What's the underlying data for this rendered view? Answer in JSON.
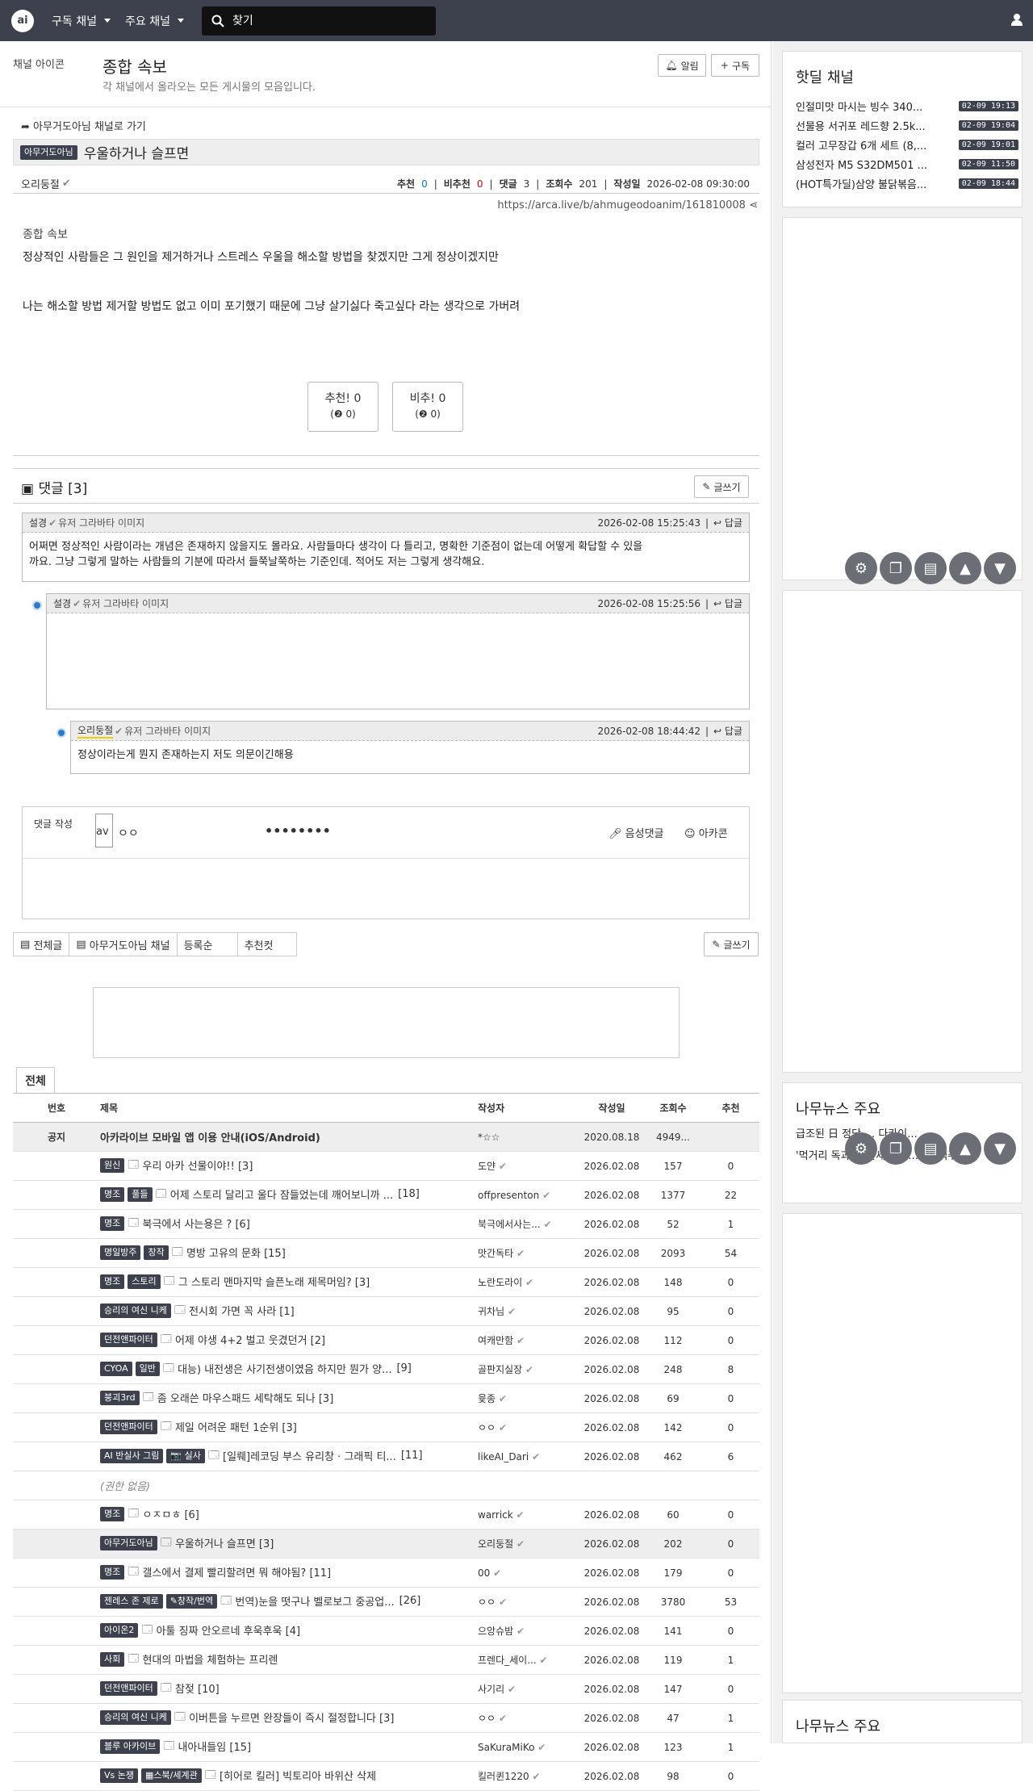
{
  "nav": {
    "menu1": "구독 채널",
    "menu2": "주요 채널",
    "search_placeholder": "찾기"
  },
  "channel": {
    "img_alt": "채널 아이콘",
    "title": "종합 속보",
    "desc": "각 채널에서 올라오는 모든 게시물의 모음입니다.",
    "alarm": "알림",
    "subscribe": "구독"
  },
  "article": {
    "back": "아무거도아님 채널로 가기",
    "category": "아무거도아님",
    "title": "우울하거나 슬프면",
    "author": "오리둥절",
    "rec_label": "추천",
    "rec": "0",
    "unrec_label": "비추천",
    "unrec": "0",
    "cmt_label": "댓글",
    "cmt": "3",
    "views_label": "조회수",
    "views": "201",
    "date_label": "작성일",
    "date": "2026-02-08 09:30:00",
    "url": "https://arca.live/b/ahmugeodoanim/161810008",
    "img_alt": "종합 속보",
    "p1": "정상적인 사람들은 그 원인을 제거하거나 스트레스 우울을 해소할 방법을 찾겠지만 그게 정상이겠지만",
    "p2": "나는 해소할 방법 제거할 방법도 없고 이미 포기했기 때문에 그냥 살기싫다 죽고싶다 라는 생각으로 가버려",
    "vote_up": "추천! 0",
    "vote_up_sub": "(❷ 0)",
    "vote_down": "비추! 0",
    "vote_down_sub": "(❷ 0)"
  },
  "comments": {
    "header": "댓글 [3]",
    "write": "글쓰기",
    "avatar_alt": "유저 그라바타 이미지",
    "reply": "답글",
    "items": [
      {
        "author": "설경",
        "date": "2026-02-08 15:25:43",
        "text1": "어쩌면 정상적인 사람이라는 개념은 존재하지 않을지도 몰라요. 사람들마다 생각이 다 틀리고, 명확한 기준점이 없는데 어떻게 확답할 수 있을",
        "text2": "까요. 그냥 그렇게 말하는 사람들의 기분에 따라서 들쭉날쭉하는 기준인데. 적어도 저는 그렇게 생각해요."
      },
      {
        "author": "설경",
        "date": "2026-02-08 15:25:56",
        "text1": ""
      },
      {
        "author": "오리둥절",
        "date": "2026-02-08 18:44:42",
        "text1": "정상이라는게 뭔지 존재하는지 저도 의문이긴해용"
      }
    ],
    "compose_label": "댓글 작성",
    "compose_avatar": "av",
    "compose_name": "ㅇㅇ",
    "compose_pw": "••••••••",
    "voice": "음성댓글",
    "arcacon": "아카콘"
  },
  "tabs": {
    "all": "전체글",
    "channel": "아무거도아님 채널",
    "order": "등록순",
    "best": "추천컷",
    "write": "글쓰기"
  },
  "list": {
    "tab": "전체",
    "cols": {
      "no": "번호",
      "title": "제목",
      "author": "작성자",
      "date": "작성일",
      "views": "조회수",
      "rec": "추천"
    },
    "notice": {
      "no": "공지",
      "title": "아카라이브 모바일 앱 이용 안내(iOS/Android)",
      "author": "*☆☆",
      "date": "2020.08.18",
      "views": "4949...",
      "rec": ""
    },
    "rows": [
      {
        "badges": [
          "원신"
        ],
        "title": "우리 아카 선물이야!! [3]",
        "cnt": "",
        "author": "도얀",
        "date": "2026.02.08",
        "views": "157",
        "rec": "0"
      },
      {
        "badges": [
          "명조",
          "풀들"
        ],
        "title": "어제 스토리 달리고 울다 잠들었는데 깨어보니까 ...",
        "cnt": "[18]",
        "author": "offpresenton",
        "date": "2026.02.08",
        "views": "1377",
        "rec": "22"
      },
      {
        "badges": [
          "명조"
        ],
        "title": "북극에서 사는용은 ? [6]",
        "cnt": "",
        "author": "북극에서사는...",
        "date": "2026.02.08",
        "views": "52",
        "rec": "1"
      },
      {
        "badges": [
          "명일방주",
          "창작"
        ],
        "title": "명방 고유의 문화 [15]",
        "cnt": "",
        "author": "맛간독타",
        "date": "2026.02.08",
        "views": "2093",
        "rec": "54"
      },
      {
        "badges": [
          "명조",
          "스토리"
        ],
        "title": "그 스토리 맨마지막 슬픈노래 제목머임? [3]",
        "cnt": "",
        "author": "노란도라이",
        "date": "2026.02.08",
        "views": "148",
        "rec": "0"
      },
      {
        "badges": [
          "승리의 여신 니케"
        ],
        "title": "전시회 가면 꼭 사라 [1]",
        "cnt": "",
        "author": "귀차님",
        "date": "2026.02.08",
        "views": "95",
        "rec": "0"
      },
      {
        "badges": [
          "던전앤파이터"
        ],
        "title": "어제 야생 4+2 벌고 웃겼던거 [2]",
        "cnt": "",
        "author": "여캐만함",
        "date": "2026.02.08",
        "views": "112",
        "rec": "0"
      },
      {
        "badges": [
          "CYOA",
          "일반"
        ],
        "title": "대능) 내전생은 사기전생이였음 하지만 뭔가 양...",
        "cnt": "[9]",
        "author": "골판지실장",
        "date": "2026.02.08",
        "views": "248",
        "rec": "8"
      },
      {
        "badges": [
          "붕괴3rd"
        ],
        "title": "좀 오래쓴 마우스패드 세탁해도 되나 [3]",
        "cnt": "",
        "author": "윷종",
        "date": "2026.02.08",
        "views": "69",
        "rec": "0"
      },
      {
        "badges": [
          "던전앤파이터"
        ],
        "title": "제일 어려운 패턴 1순위 [3]",
        "cnt": "",
        "author": "ㅇㅇ",
        "date": "2026.02.08",
        "views": "142",
        "rec": "0"
      },
      {
        "badges": [
          "AI 반실사 그림",
          "📷 실사"
        ],
        "title": "[일뤠]레코딩 부스 유리창 · 그래픽 티...",
        "cnt": "[11]",
        "author": "likeAI_Dari",
        "date": "2026.02.08",
        "views": "462",
        "rec": "6"
      },
      {
        "perm": "(권한 없음)"
      },
      {
        "badges": [
          "명조"
        ],
        "title": "ㅇㅈㅁㅎ [6]",
        "cnt": "",
        "author": "warrick",
        "date": "2026.02.08",
        "views": "60",
        "rec": "0"
      },
      {
        "badges": [
          "아무거도아님"
        ],
        "title": "우울하거나 슬프면 [3]",
        "cnt": "",
        "author": "오리둥절",
        "date": "2026.02.08",
        "views": "202",
        "rec": "0",
        "current": true
      },
      {
        "badges": [
          "명조"
        ],
        "title": "갤스에서 결제 빨리할려면 뭐 해야됨? [11]",
        "cnt": "",
        "author": "00",
        "date": "2026.02.08",
        "views": "179",
        "rec": "0"
      },
      {
        "badges": [
          "젠레스 존 제로",
          "✎창작/번역"
        ],
        "title": "번역)눈을 떳구나 벨로보그 중공업...",
        "cnt": "[26]",
        "author": "ㅇㅇ",
        "date": "2026.02.08",
        "views": "3780",
        "rec": "53"
      },
      {
        "badges": [
          "아이온2"
        ],
        "title": "아툴 징짜 안오르네 후욱후욱 [4]",
        "cnt": "",
        "author": "으앙슈밤",
        "date": "2026.02.08",
        "views": "141",
        "rec": "0"
      },
      {
        "badges": [
          "사회"
        ],
        "title": "현대의 마법을 체험하는 프리렌",
        "cnt": "",
        "author": "프렌다_세이...",
        "date": "2026.02.08",
        "views": "119",
        "rec": "1"
      },
      {
        "badges": [
          "던전앤파이터"
        ],
        "title": "참젖 [10]",
        "cnt": "",
        "author": "사기리",
        "date": "2026.02.08",
        "views": "147",
        "rec": "0"
      },
      {
        "badges": [
          "승리의 여신 니케"
        ],
        "title": "이버튼을 누르면 완장들이 즉시 절정합니다 [3]",
        "cnt": "",
        "author": "ㅇㅇ",
        "date": "2026.02.08",
        "views": "47",
        "rec": "1"
      },
      {
        "badges": [
          "블루 아카이브"
        ],
        "title": "내아내들임 [15]",
        "cnt": "",
        "author": "SaKuraMiKo",
        "date": "2026.02.08",
        "views": "123",
        "rec": "1"
      },
      {
        "badges": [
          "Vs 논쟁",
          "▦스북/세계관"
        ],
        "title": "[히어로 킬러] 빅토리아 바위산 삭제",
        "cnt": "",
        "author": "킬러퀸1220",
        "date": "2026.02.08",
        "views": "98",
        "rec": "0"
      }
    ]
  },
  "sidebar": {
    "hot_title": "핫딜 채널",
    "hot": [
      {
        "t": "인절미맛 마시는 빙수 340...",
        "d": "02-09 19:13"
      },
      {
        "t": "선물용 서귀포 레드향 2.5k...",
        "d": "02-09 19:04"
      },
      {
        "t": "컬러 고무장갑 6개 세트 (8,...",
        "d": "02-09 19:01"
      },
      {
        "t": "삼성전자 M5 S32DM501 ...",
        "d": "02-09 11:50"
      },
      {
        "t": "(HOT특가딜)삼양 불닭볶음...",
        "d": "02-09 18:44"
      }
    ],
    "news_title": "나무뉴스 주요",
    "news1": "급조된 日 정당 … 다카이...",
    "news2": "'먹거리 독과점' 탈세 적발…오비맥주 1..."
  }
}
